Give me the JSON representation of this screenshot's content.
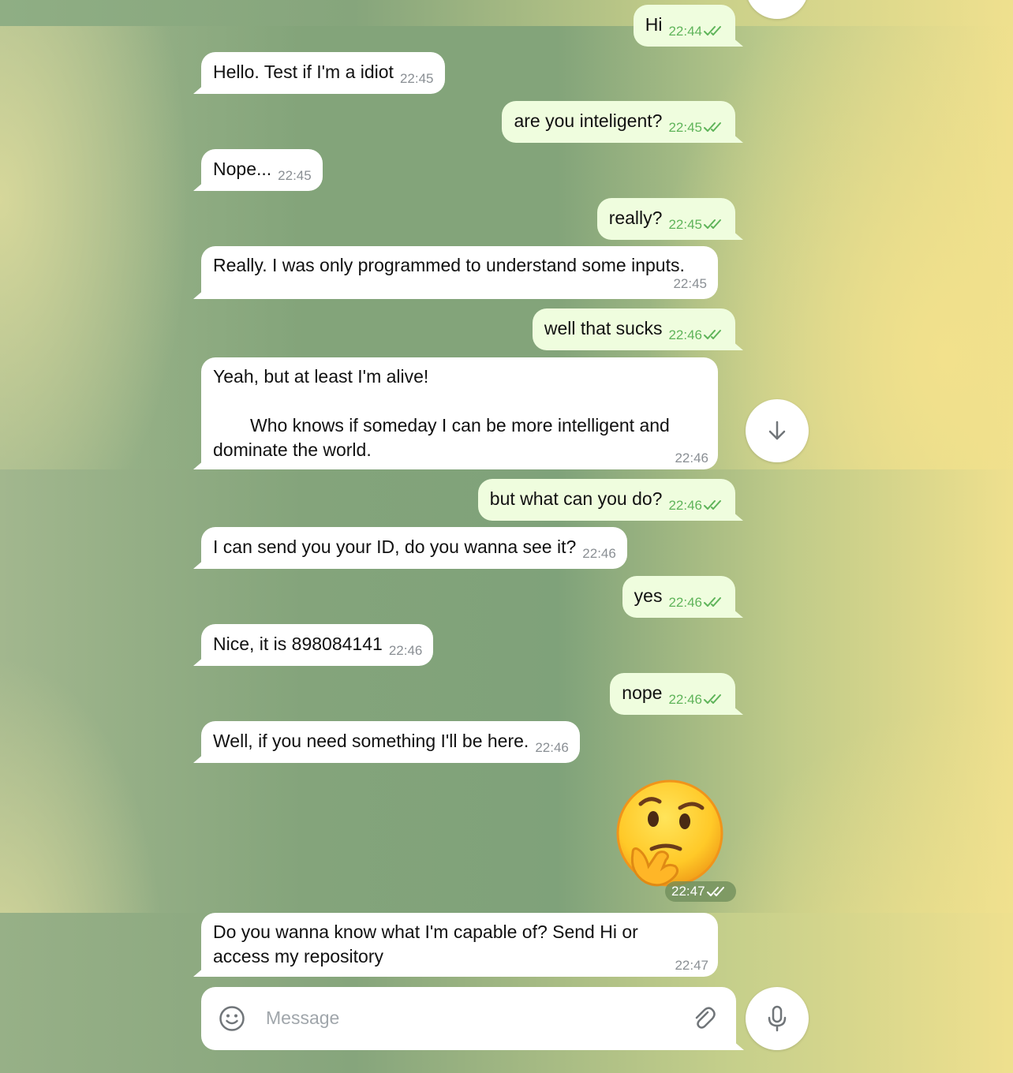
{
  "messages": [
    {
      "dir": "out",
      "text": "Hi",
      "time": "22:44"
    },
    {
      "dir": "in",
      "text": "Hello. Test if I'm a idiot",
      "time": "22:45"
    },
    {
      "dir": "out",
      "text": "are you inteligent?",
      "time": "22:45"
    },
    {
      "dir": "in",
      "text": "Nope...",
      "time": "22:45"
    },
    {
      "dir": "out",
      "text": "really?",
      "time": "22:45"
    },
    {
      "dir": "in",
      "text": "Really. I was only programmed to understand some inputs.",
      "time": "22:45"
    },
    {
      "dir": "out",
      "text": "well that sucks",
      "time": "22:46"
    },
    {
      "dir": "in",
      "text_line1": "Yeah, but at least I'm alive!",
      "text_line2": "Who knows if someday I can be more intelligent and",
      "text_line3": "dominate the world.",
      "time": "22:46"
    },
    {
      "dir": "out",
      "text": "but what can you do?",
      "time": "22:46"
    },
    {
      "dir": "in",
      "text": "I can send you your ID, do you wanna see it?",
      "time": "22:46"
    },
    {
      "dir": "out",
      "text": "yes",
      "time": "22:46"
    },
    {
      "dir": "in",
      "text": "Nice, it is 898084141",
      "time": "22:46"
    },
    {
      "dir": "out",
      "text": "nope",
      "time": "22:46"
    },
    {
      "dir": "in",
      "text": "Well, if you need something I'll be here.",
      "time": "22:46"
    },
    {
      "dir": "out",
      "sticker": "thinking-face-emoji",
      "time": "22:47"
    },
    {
      "dir": "in",
      "text_line1": "Do you wanna know what I'm capable of? Send Hi or",
      "text_line2": "access my repository",
      "time": "22:47"
    }
  ],
  "composer": {
    "placeholder": "Message"
  },
  "icons": {
    "scroll_down": "arrow-down-icon",
    "emoji": "smiley-icon",
    "attach": "paperclip-icon",
    "mic": "microphone-icon"
  },
  "colors": {
    "incoming_bubble": "#ffffff",
    "outgoing_bubble": "#effdde",
    "outgoing_time": "#5fb45a",
    "read_ticks": "#5fb45a"
  }
}
